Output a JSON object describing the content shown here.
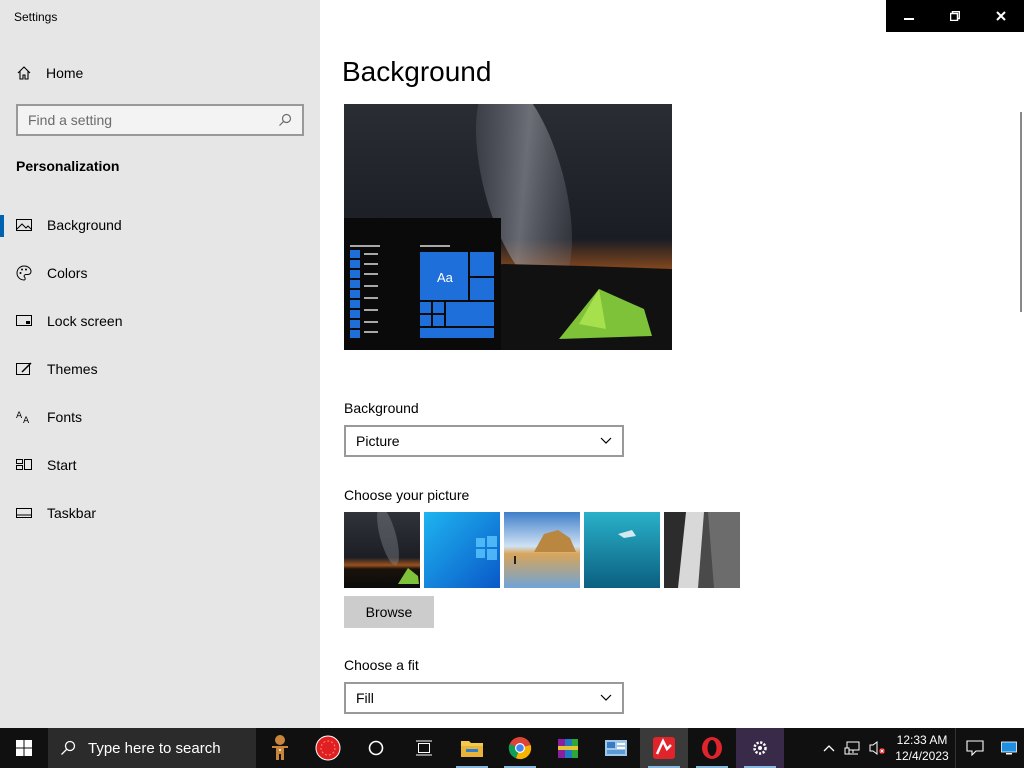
{
  "window": {
    "title": "Settings"
  },
  "sidebar": {
    "home_label": "Home",
    "search_placeholder": "Find a setting",
    "section_title": "Personalization",
    "items": [
      {
        "label": "Background",
        "icon": "picture-icon",
        "active": true
      },
      {
        "label": "Colors",
        "icon": "palette-icon",
        "active": false
      },
      {
        "label": "Lock screen",
        "icon": "lock-screen-icon",
        "active": false
      },
      {
        "label": "Themes",
        "icon": "brush-icon",
        "active": false
      },
      {
        "label": "Fonts",
        "icon": "font-icon",
        "active": false
      },
      {
        "label": "Start",
        "icon": "start-menu-icon",
        "active": false
      },
      {
        "label": "Taskbar",
        "icon": "taskbar-icon",
        "active": false
      }
    ]
  },
  "main": {
    "page_title": "Background",
    "preview_tile_text": "Aa",
    "background_label": "Background",
    "background_value": "Picture",
    "choose_picture_label": "Choose your picture",
    "pictures": [
      "milky-way-tent",
      "windows-blue",
      "beach-rocks",
      "underwater-swimmer",
      "waterfall-cliff"
    ],
    "browse_label": "Browse",
    "fit_label": "Choose a fit",
    "fit_value": "Fill"
  },
  "taskbar": {
    "search_text": "Type here to search",
    "apps": [
      "gingerbread-icon",
      "red-circle-icon",
      "cortana-icon",
      "task-view-icon",
      "file-explorer-icon",
      "chrome-icon",
      "winrar-icon",
      "control-panel-icon",
      "avira-icon",
      "opera-icon",
      "settings-gear-icon"
    ],
    "time": "12:33 AM",
    "date": "12/4/2023"
  },
  "colors": {
    "accent": "#0078d7",
    "sidebar_bg": "#e6e6e6",
    "taskbar_bg": "#101010"
  }
}
